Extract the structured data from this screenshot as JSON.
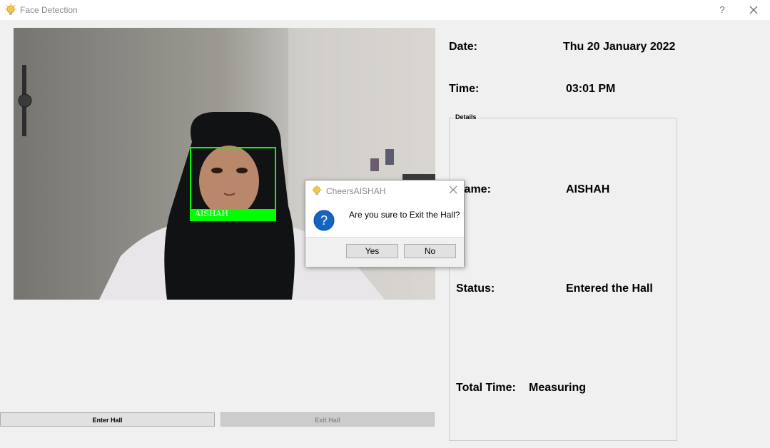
{
  "window": {
    "title": "Face Detection",
    "help_label": "?"
  },
  "camera": {
    "overlay_label": "AISHAH"
  },
  "buttons": {
    "enter_label": "Enter Hall",
    "exit_label": "Exit Hall"
  },
  "info": {
    "date_label": "Date:",
    "date_value": "Thu 20 January 2022",
    "time_label": "Time:",
    "time_value": "03:01 PM",
    "group_title": "Details",
    "name_label": "Name:",
    "name_value": "AISHAH",
    "status_label": "Status:",
    "status_value": "Entered the Hall",
    "total_label": "Total Time:",
    "total_value": "Measuring"
  },
  "dialog": {
    "title": "CheersAISHAH",
    "message": "Are you sure to Exit the Hall?",
    "yes_label": "Yes",
    "no_label": "No"
  },
  "colors": {
    "detection_box": "#00ff00",
    "dialog_icon": "#1565c0"
  }
}
